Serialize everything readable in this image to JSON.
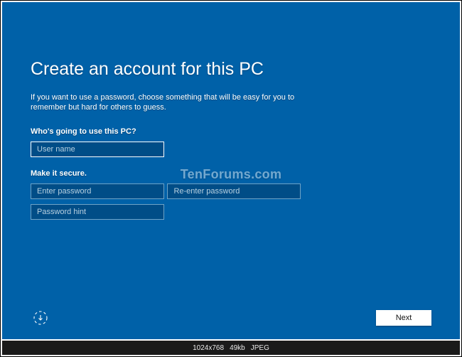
{
  "setup": {
    "title": "Create an account for this PC",
    "subtitle": "If you want to use a password, choose something that will be easy for you to remember but hard for others to guess.",
    "section_user_label": "Who's going to use this PC?",
    "section_password_label": "Make it secure.",
    "fields": {
      "username_placeholder": "User name",
      "password_placeholder": "Enter password",
      "confirm_placeholder": "Re-enter password",
      "hint_placeholder": "Password hint"
    },
    "next_label": "Next"
  },
  "watermark": "TenForums.com",
  "statusbar": {
    "dimensions": "1024x768",
    "size": "49kb",
    "format": "JPEG"
  }
}
